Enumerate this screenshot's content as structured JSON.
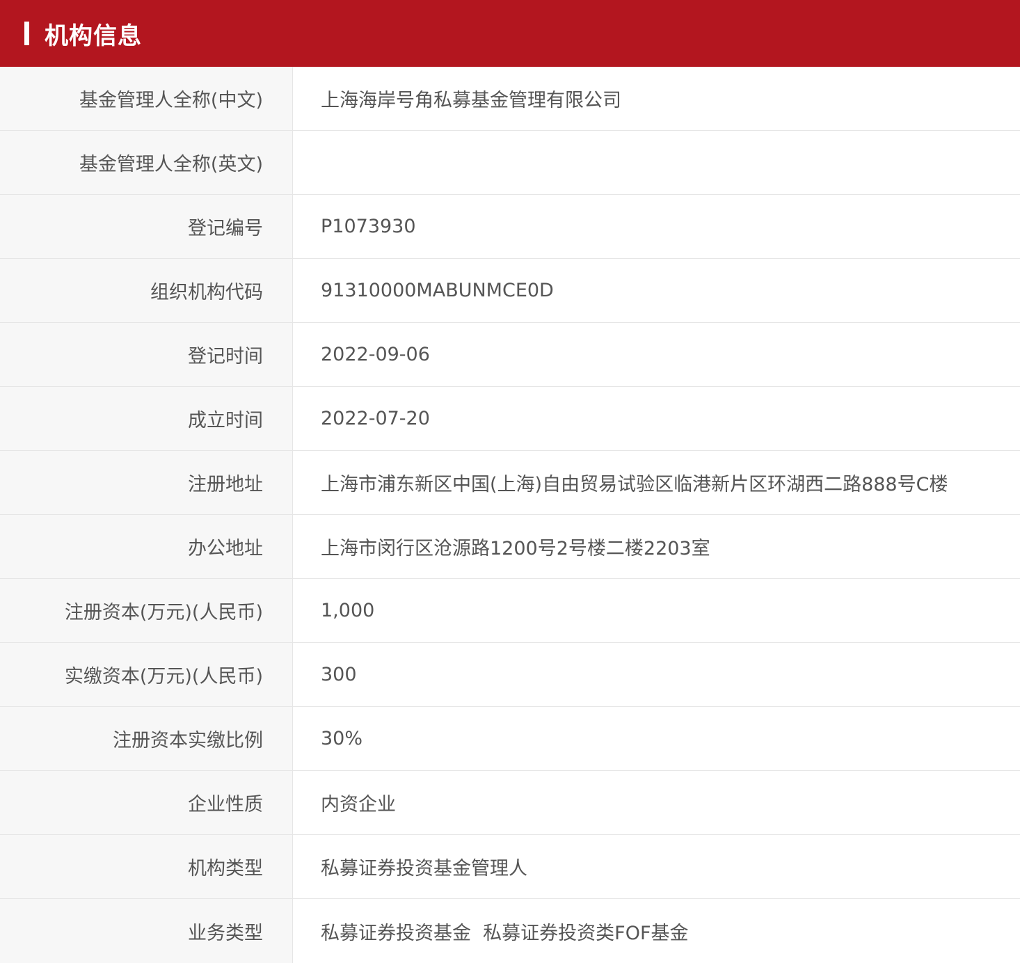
{
  "header": {
    "title": "机构信息",
    "background_color": "#b3161f"
  },
  "rows": [
    {
      "label": "基金管理人全称(中文)",
      "value": "上海海岸号角私募基金管理有限公司"
    },
    {
      "label": "基金管理人全称(英文)",
      "value": ""
    },
    {
      "label": "登记编号",
      "value": "P1073930"
    },
    {
      "label": "组织机构代码",
      "value": "91310000MABUNMCE0D"
    },
    {
      "label": "登记时间",
      "value": "2022-09-06"
    },
    {
      "label": "成立时间",
      "value": "2022-07-20"
    },
    {
      "label": "注册地址",
      "value": "上海市浦东新区中国(上海)自由贸易试验区临港新片区环湖西二路888号C楼"
    },
    {
      "label": "办公地址",
      "value": "上海市闵行区沧源路1200号2号楼二楼2203室"
    },
    {
      "label": "注册资本(万元)(人民币)",
      "value": "1,000"
    },
    {
      "label": "实缴资本(万元)(人民币)",
      "value": "300"
    },
    {
      "label": "注册资本实缴比例",
      "value": "30%"
    },
    {
      "label": "企业性质",
      "value": "内资企业"
    },
    {
      "label": "机构类型",
      "value": "私募证券投资基金管理人"
    },
    {
      "label": "业务类型",
      "value": "私募证券投资基金  私募证券投资类FOF基金"
    }
  ]
}
